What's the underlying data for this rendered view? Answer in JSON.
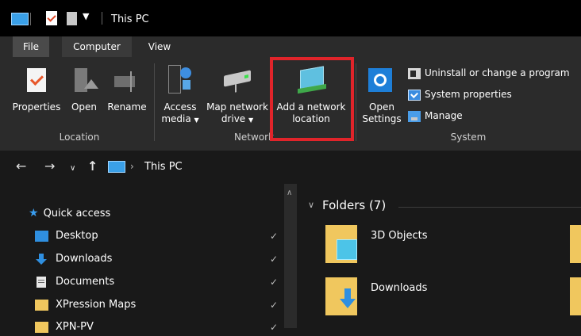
{
  "window": {
    "title": "This PC"
  },
  "colors": {
    "accent": "#0078d7",
    "highlight": "#e0242a",
    "folder": "#f0c75e"
  },
  "tabs": [
    {
      "label": "File"
    },
    {
      "label": "Computer"
    },
    {
      "label": "View"
    }
  ],
  "ribbon": {
    "location": {
      "properties": "Properties",
      "open": "Open",
      "rename": "Rename",
      "group": "Location"
    },
    "network": {
      "access_media_1": "Access",
      "access_media_2": "media",
      "map_drive_1": "Map network",
      "map_drive_2": "drive",
      "add_location_1": "Add a network",
      "add_location_2": "location",
      "group": "Network"
    },
    "system": {
      "open_settings_1": "Open",
      "open_settings_2": "Settings",
      "uninstall": "Uninstall or change a program",
      "system_properties": "System properties",
      "manage": "Manage",
      "group": "System"
    }
  },
  "address": {
    "path": "This PC"
  },
  "nav": {
    "quick_access": "Quick access",
    "items": [
      {
        "label": "Desktop",
        "icon": "desktop-icon"
      },
      {
        "label": "Downloads",
        "icon": "downloads-icon"
      },
      {
        "label": "Documents",
        "icon": "documents-icon"
      },
      {
        "label": "XPression Maps",
        "icon": "folder-icon"
      },
      {
        "label": "XPN-PV",
        "icon": "folder-icon"
      }
    ]
  },
  "main": {
    "section": "Folders (7)",
    "folders": [
      {
        "label": "3D Objects"
      },
      {
        "label": "Downloads"
      }
    ]
  }
}
